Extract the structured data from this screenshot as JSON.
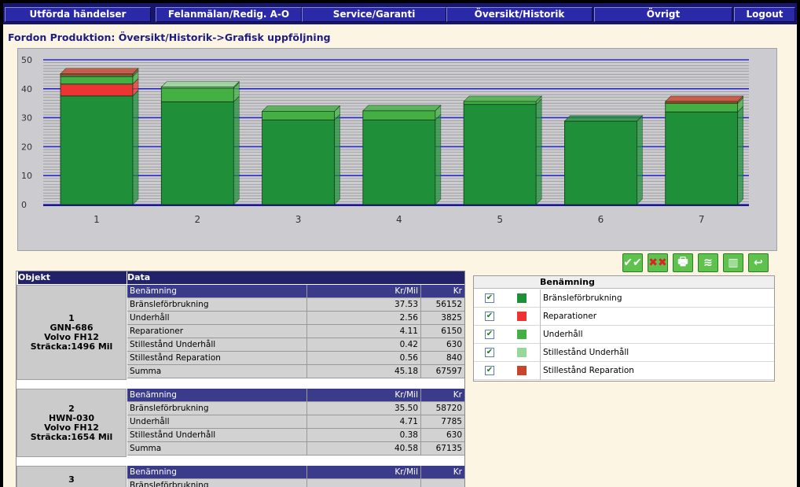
{
  "nav": [
    {
      "label": "Utförda händelser",
      "name": "nav-utforda-handelser"
    },
    {
      "label": "Felanmälan/Redig. A-O",
      "name": "nav-felanmalan"
    },
    {
      "label": "Service/Garanti",
      "name": "nav-service-garanti"
    },
    {
      "label": "Översikt/Historik",
      "name": "nav-oversikt-historik"
    },
    {
      "label": "Övrigt",
      "name": "nav-ovrigt"
    },
    {
      "label": "Logout",
      "name": "nav-logout"
    }
  ],
  "breadcrumb": "Fordon Produktion: Översikt/Historik->Grafisk uppföljning",
  "chart_data": {
    "type": "bar",
    "stacked": true,
    "categories": [
      "1",
      "2",
      "3",
      "4",
      "5",
      "6",
      "7"
    ],
    "ylim": [
      0,
      50
    ],
    "yticks": [
      "0",
      "10",
      "20",
      "30",
      "40",
      "50"
    ],
    "grid": true,
    "series": [
      {
        "name": "Bränsleförbrukning",
        "color": "#1f8f3a",
        "values": [
          37.53,
          35.5,
          29.2,
          29.2,
          34.6,
          28.8,
          32.0
        ]
      },
      {
        "name": "Reparationer",
        "color": "#ee3333",
        "values": [
          4.11,
          0,
          0,
          0,
          0,
          0,
          0
        ]
      },
      {
        "name": "Underhåll",
        "color": "#44b044",
        "values": [
          2.56,
          4.71,
          3.0,
          3.2,
          1.0,
          0,
          3.0
        ]
      },
      {
        "name": "Stillestånd Underhåll",
        "color": "#99d699",
        "values": [
          0.42,
          0.38,
          0,
          0,
          0,
          0,
          0
        ]
      },
      {
        "name": "Stillestånd Reparation",
        "color": "#c9442c",
        "values": [
          0.56,
          0,
          0,
          0,
          0,
          0,
          0.6
        ]
      }
    ]
  },
  "toolbar": [
    {
      "name": "check-all-button",
      "glyph": "✔✔"
    },
    {
      "name": "uncheck-all-button",
      "glyph": "✖✖"
    },
    {
      "name": "print-button",
      "glyph": "🖶"
    },
    {
      "name": "line-chart-button",
      "glyph": "≋"
    },
    {
      "name": "bar-chart-button",
      "glyph": "▥"
    },
    {
      "name": "back-button",
      "glyph": "↩"
    }
  ],
  "table": {
    "col_objekt": "Objekt",
    "col_data": "Data",
    "objects": [
      {
        "lines": [
          "1",
          "GNN-686",
          "Volvo FH12",
          "Sträcka:1496 Mil"
        ],
        "header": [
          "Benämning",
          "Kr/Mil",
          "Kr"
        ],
        "rows": [
          [
            "Bränsleförbrukning",
            "37.53",
            "56152"
          ],
          [
            "Underhåll",
            "2.56",
            "3825"
          ],
          [
            "Reparationer",
            "4.11",
            "6150"
          ],
          [
            "Stillestånd Underhåll",
            "0.42",
            "630"
          ],
          [
            "Stillestånd Reparation",
            "0.56",
            "840"
          ],
          [
            "Summa",
            "45.18",
            "67597"
          ]
        ]
      },
      {
        "lines": [
          "2",
          "HWN-030",
          "Volvo FH12",
          "Sträcka:1654 Mil"
        ],
        "header": [
          "Benämning",
          "Kr/Mil",
          "Kr"
        ],
        "rows": [
          [
            "Bränsleförbrukning",
            "35.50",
            "58720"
          ],
          [
            "Underhåll",
            "4.71",
            "7785"
          ],
          [
            "Stillestånd Underhåll",
            "0.38",
            "630"
          ],
          [
            "Summa",
            "40.58",
            "67135"
          ]
        ]
      },
      {
        "lines": [
          "3"
        ],
        "header": [
          "Benämning",
          "Kr/Mil",
          "Kr"
        ],
        "rows": [
          [
            "Bränsleförbrukning",
            "",
            ""
          ]
        ]
      }
    ]
  },
  "legend": {
    "header": "Benämning",
    "items": [
      {
        "label": "Bränsleförbrukning",
        "color": "#1f8f3a",
        "checked": true
      },
      {
        "label": "Reparationer",
        "color": "#ee3333",
        "checked": true
      },
      {
        "label": "Underhåll",
        "color": "#44b044",
        "checked": true
      },
      {
        "label": "Stillestånd Underhåll",
        "color": "#99d699",
        "checked": true
      },
      {
        "label": "Stillestånd Reparation",
        "color": "#c9442c",
        "checked": true
      }
    ]
  }
}
